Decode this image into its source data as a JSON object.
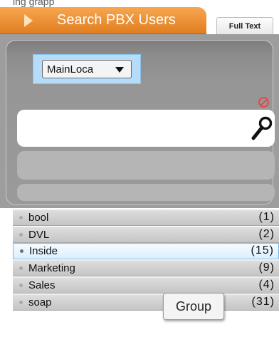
{
  "top_fragment": "ing grapp",
  "tabs": {
    "search_label": "Search PBX Users",
    "fulltext_label": "Full Text"
  },
  "search": {
    "location_value": "MainLoca",
    "query_value": ""
  },
  "groups": [
    {
      "name": "bool",
      "count": "(1)"
    },
    {
      "name": "DVL",
      "count": "(2)"
    },
    {
      "name": "Inside",
      "count": "(15)",
      "selected": true
    },
    {
      "name": "Marketing",
      "count": "(9)"
    },
    {
      "name": "Sales",
      "count": "(4)"
    },
    {
      "name": "soap",
      "count": "(31)"
    }
  ],
  "tooltip": "Group",
  "colors": {
    "tab_orange": "#e8872b",
    "panel_gray": "#9a9a9a",
    "selection_blue": "#b5dcf9",
    "clear_red": "#e04a4a"
  },
  "icons": {
    "tab": "play-icon",
    "clear": "clear-icon",
    "search": "search-icon",
    "dropdown": "chevron-down-icon"
  }
}
